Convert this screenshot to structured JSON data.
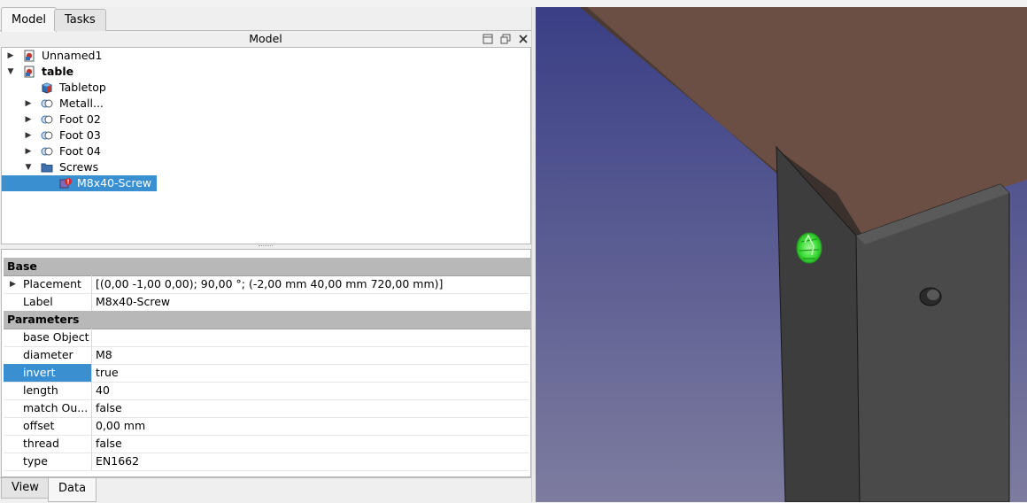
{
  "tabs": [
    "Model",
    "Tasks"
  ],
  "panel": {
    "title": "Model"
  },
  "tree": [
    {
      "label": "Unnamed1",
      "indent": 0,
      "arrow": "right",
      "icon": "document-icon",
      "bold": false
    },
    {
      "label": "table",
      "indent": 0,
      "arrow": "down",
      "icon": "document-icon",
      "bold": true
    },
    {
      "label": "Tabletop",
      "indent": 1,
      "arrow": "",
      "icon": "cube-icon",
      "bold": false
    },
    {
      "label": "Metall...",
      "indent": 1,
      "arrow": "right",
      "icon": "array-icon",
      "bold": false
    },
    {
      "label": "Foot 02",
      "indent": 1,
      "arrow": "right",
      "icon": "array-icon",
      "bold": false
    },
    {
      "label": "Foot 03",
      "indent": 1,
      "arrow": "right",
      "icon": "array-icon",
      "bold": false
    },
    {
      "label": "Foot 04",
      "indent": 1,
      "arrow": "right",
      "icon": "array-icon",
      "bold": false
    },
    {
      "label": "Screws",
      "indent": 1,
      "arrow": "down",
      "icon": "folder-icon",
      "bold": false
    },
    {
      "label": "M8x40-Screw",
      "indent": 2,
      "arrow": "",
      "icon": "screw-error-icon",
      "bold": false,
      "selected": true
    }
  ],
  "properties": {
    "base_group": "Base",
    "base": [
      {
        "name": "Placement",
        "value": "[(0,00 -1,00 0,00); 90,00 °; (-2,00 mm  40,00 mm  720,00 mm)]",
        "expandable": true
      },
      {
        "name": "Label",
        "value": "M8x40-Screw"
      }
    ],
    "param_group": "Parameters",
    "params": [
      {
        "name": "base Object",
        "value": ""
      },
      {
        "name": "diameter",
        "value": "M8"
      },
      {
        "name": "invert",
        "value": "true",
        "selected": true
      },
      {
        "name": "length",
        "value": "40"
      },
      {
        "name": "match Ou...",
        "value": "false"
      },
      {
        "name": "offset",
        "value": "0,00 mm"
      },
      {
        "name": "thread",
        "value": "false"
      },
      {
        "name": "type",
        "value": "EN1662"
      }
    ]
  },
  "bottom_tabs": [
    "View",
    "Data"
  ],
  "colors": {
    "selection": "#3a8fd0",
    "viewport_top": "#3a3f86",
    "viewport_bottom": "#7d7c9f",
    "tabletop": "#6b4f45",
    "leg": "#3c3c3c",
    "screw": "#3fe03a"
  }
}
